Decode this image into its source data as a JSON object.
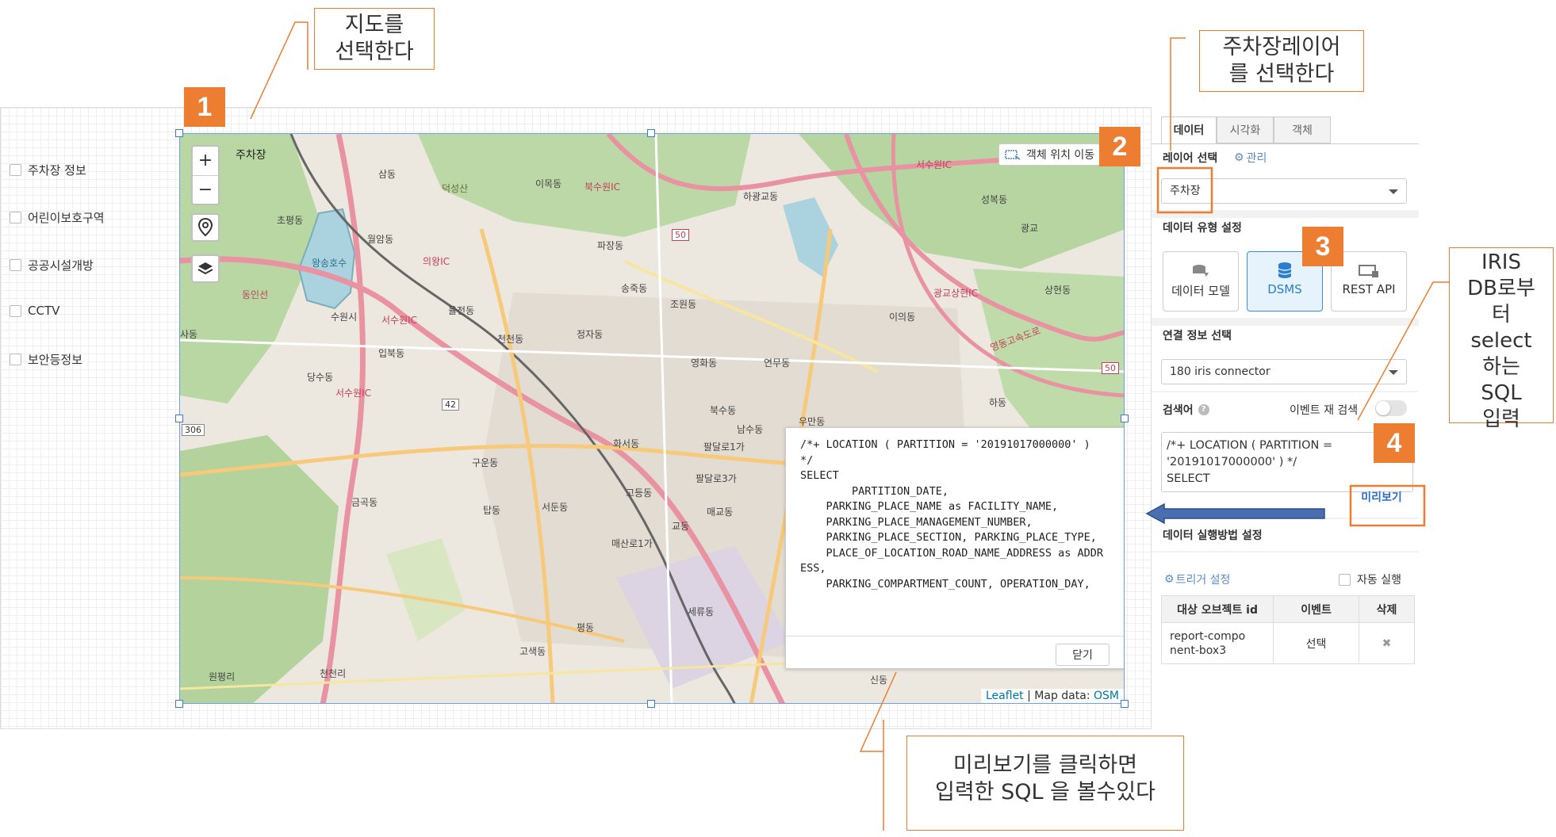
{
  "left_list": [
    "주차장 정보",
    "어린이보호구역",
    "공공시설개방",
    "CCTV",
    "보안등정보"
  ],
  "map": {
    "zoom_in": "+",
    "zoom_out": "−",
    "move_objects_label": "객체 위치 이동",
    "attribution": {
      "leaflet": "Leaflet",
      "sep": " | Map data: ",
      "osm": "OSM"
    },
    "place_labels": [
      "주차장",
      "삼동",
      "이목동",
      "북수원IC",
      "하광교동",
      "서수원IC",
      "성복동",
      "덕성산",
      "초평동",
      "월암동",
      "왕송호수",
      "의왕IC",
      "파장동",
      "송죽동",
      "조원동",
      "광교상현IC",
      "상현동",
      "동인선",
      "율전동",
      "정자동",
      "천천동",
      "영화동",
      "연무동",
      "이의동",
      "입북동",
      "당수동",
      "서수원IC",
      "영동고속도로",
      "북수동",
      "우만동",
      "남수동",
      "화서동",
      "팔달로1가",
      "팔달로3가",
      "구운동",
      "고등동",
      "서둔동",
      "탑동",
      "금곡동",
      "매산로1가",
      "교동",
      "매교동",
      "세류동",
      "평동",
      "고색동",
      "천천리",
      "원평리",
      "신동",
      "하동",
      "광교",
      "수원시",
      "서수원IC",
      "사동"
    ],
    "road_numbers": [
      "50",
      "42",
      "306",
      "50"
    ]
  },
  "sql_popup": {
    "text": "/*+ LOCATION ( PARTITION = '20191017000000' ) */\nSELECT\n        PARTITION_DATE,\n    PARKING_PLACE_NAME as FACILITY_NAME,\n    PARKING_PLACE_MANAGEMENT_NUMBER,\n    PARKING_PLACE_SECTION, PARKING_PLACE_TYPE,\n    PLACE_OF_LOCATION_ROAD_NAME_ADDRESS as ADDRESS,\n    PARKING_COMPARTMENT_COUNT, OPERATION_DAY,",
    "close_label": "닫기"
  },
  "panel": {
    "tabs": [
      "데이터",
      "시각화",
      "객체"
    ],
    "layer_select_title": "레이어 선택",
    "manage_label": "관리",
    "layer_value": "주차장",
    "data_type_title": "데이터 유형 설정",
    "data_types": [
      "데이터 모델",
      "DSMS",
      "REST API"
    ],
    "connection_title": "연결 정보 선택",
    "connection_value": "180 iris connector",
    "query_title": "검색어",
    "event_research_label": "이벤트 재 검색",
    "query_text": "/*+ LOCATION ( PARTITION =\n'20191017000000' ) */\nSELECT",
    "preview_label": "미리보기",
    "exec_title": "데이터 실행방법 설정",
    "trigger_label": "트리거 설정",
    "auto_run_label": "자동 실행",
    "table_headers": [
      "대상 오브젝트 id",
      "이벤트",
      "삭제"
    ],
    "table_row": {
      "id": "report-compo\nnent-box3",
      "event": "선택",
      "delete": "✖"
    }
  },
  "annotations": {
    "step1": "1",
    "step2": "2",
    "step3": "3",
    "step4": "4",
    "note_select_map": "지도를\n선택한다",
    "note_select_layer": "주차장레이어\n를 선택한다",
    "note_iris": "IRIS\nDB로부\n터\nselect\n하는\nSQL\n입력",
    "note_preview": "미리보기를 클릭하면\n입력한 SQL 을 볼수있다"
  },
  "colors": {
    "accent": "#ed7d31",
    "selection": "#3a7bd5",
    "dsms_bg": "#e6f2fc"
  }
}
